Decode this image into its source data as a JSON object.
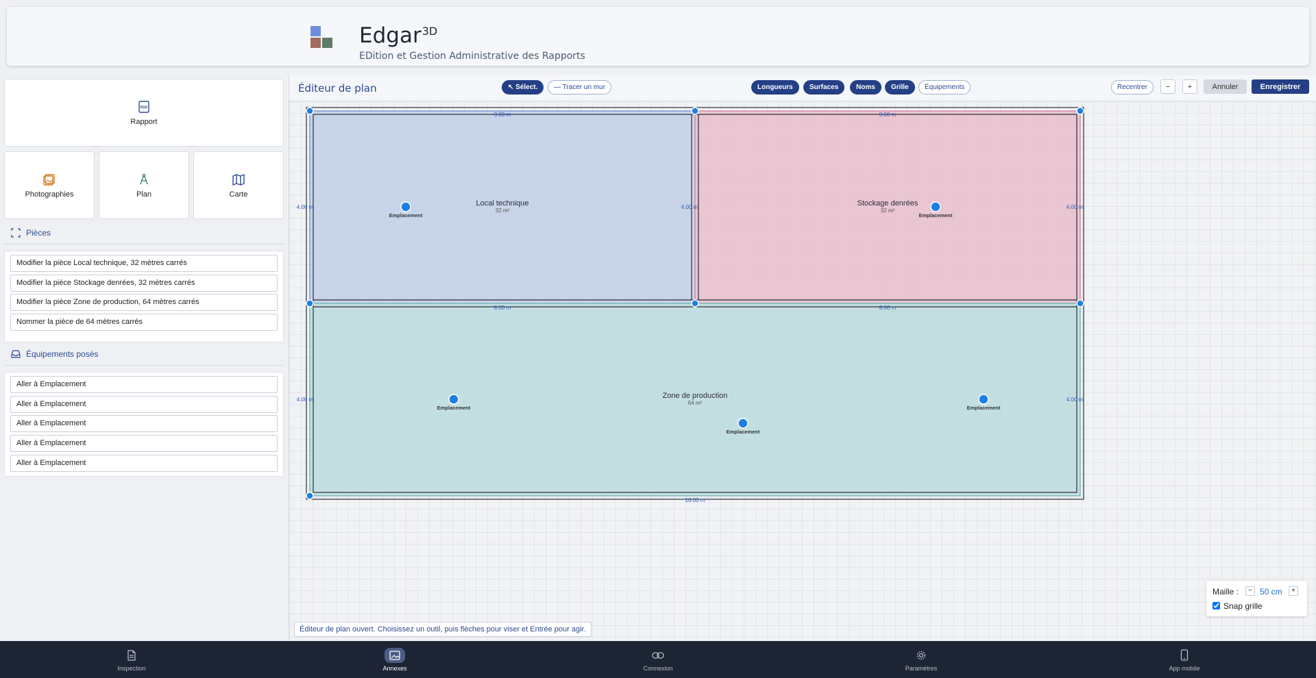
{
  "header": {
    "app_name": "Edgar",
    "app_name_sup": "3D",
    "subtitle": "EDition et Gestion Administrative des Rapports"
  },
  "tiles": {
    "rapport": "Rapport",
    "photographies": "Photographies",
    "plan": "Plan",
    "carte": "Carte"
  },
  "pieces": {
    "title": "Pièces",
    "items": [
      "Modifier la pièce Local technique, 32 mètres carrés",
      "Modifier la pièce Stockage denrées, 32 mètres carrés",
      "Modifier la pièce Zone de production, 64 mètres carrés",
      "Nommer la pièce de 64 mètres carrés"
    ]
  },
  "equipements": {
    "title": "Équipements posés",
    "items": [
      "Aller à Emplacement",
      "Aller à Emplacement",
      "Aller à Emplacement",
      "Aller à Emplacement",
      "Aller à Emplacement"
    ]
  },
  "editor": {
    "title": "Éditeur de plan",
    "tools": {
      "select": "↖ Sélect.",
      "wall": "— Tracer un mur"
    },
    "toggles": {
      "longueurs": "Longueurs",
      "surfaces": "Surfaces",
      "noms": "Noms",
      "grille": "Grille",
      "equipements": "Équipements"
    },
    "actions": {
      "recentrer": "Recentrer",
      "minus": "−",
      "plus": "+",
      "annuler": "Annuler",
      "enregistrer": "Enregistrer"
    },
    "status": "Éditeur de plan ouvert. Choisissez un outil, puis flèches pour viser et Entrée pour agir."
  },
  "plan": {
    "rooms": [
      {
        "name": "Local technique",
        "area": "32 m²",
        "color": "#b9c9e4"
      },
      {
        "name": "Stockage denrées",
        "area": "32 m²",
        "color": "#e9b9c9"
      },
      {
        "name": "Zone de production",
        "area": "64 m²",
        "color": "#b9d9dc"
      }
    ],
    "lengths": {
      "top_left": "8.00 m",
      "top_right": "8.00 m",
      "mid_left": "8.00 m",
      "mid_right": "8.00 m",
      "bottom": "16.00 m",
      "left_upper": "4.00 m",
      "left_lower": "4.00 m",
      "center_upper": "4.00 m",
      "right_upper": "4.00 m",
      "right_lower": "4.00 m"
    },
    "equipment_label": "Emplacement",
    "equipment_count": 5
  },
  "mesh": {
    "label": "Maille :",
    "minus": "−",
    "value": "50 cm",
    "plus": "+",
    "snap_label": "Snap grille",
    "snap_checked": true
  },
  "nav": {
    "inspection": "Inspection",
    "annexes": "Annexes",
    "connexion": "Connexion",
    "parametres": "Paramètres",
    "app_mobile": "App mobile",
    "active": "annexes"
  },
  "colors": {
    "primary": "#243f85",
    "accent_blue": "#1e7fe0",
    "nav_bg": "#1d2434"
  }
}
